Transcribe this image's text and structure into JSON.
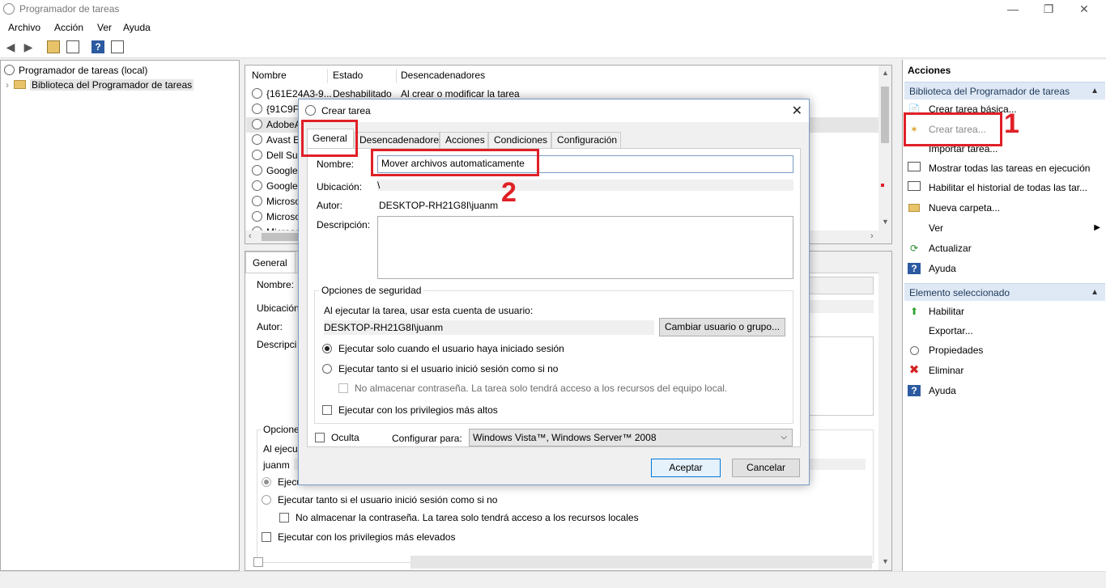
{
  "window": {
    "title": "Programador de tareas",
    "min": "—",
    "max": "❐",
    "close": "✕"
  },
  "menu": [
    "Archivo",
    "Acción",
    "Ver",
    "Ayuda"
  ],
  "tree": {
    "root": "Programador de tareas (local)",
    "child": "Biblioteca del Programador de tareas"
  },
  "list": {
    "headers": [
      "Nombre",
      "Estado",
      "Desencadenadores"
    ],
    "rows": [
      {
        "name": "{161E24A3-9...",
        "state": "Deshabilitado",
        "trigger": "Al crear o modificar la tarea"
      },
      {
        "name": "{91C9F1",
        "state": "",
        "trigger": ""
      },
      {
        "name": "AdobeA",
        "state": "",
        "trigger": ""
      },
      {
        "name": "Avast Er",
        "state": "",
        "trigger": ""
      },
      {
        "name": "Dell Sup",
        "state": "",
        "trigger": ""
      },
      {
        "name": "GoogleU",
        "state": "",
        "trigger": ""
      },
      {
        "name": "GoogleU",
        "state": "",
        "trigger": ""
      },
      {
        "name": "Microso",
        "state": "",
        "trigger": ""
      },
      {
        "name": "Microso",
        "state": "",
        "trigger": ""
      },
      {
        "name": "Microso",
        "state": "",
        "trigger": ""
      }
    ]
  },
  "detail": {
    "tab": "General",
    "nombre": "Nombre:",
    "ubicacion": "Ubicación:",
    "autor": "Autor:",
    "descripcion": "Descripci",
    "opciones": "Opcione",
    "al_ejecutar": "Al ejecu",
    "user": "juanm",
    "radio1": "Ejecu",
    "radio2": "Ejecutar tanto si el usuario inició sesión como si no",
    "chk1": "No almacenar la contraseña. La tarea solo tendrá acceso a los recursos locales",
    "chk2": "Ejecutar con los privilegios más elevados"
  },
  "actions": {
    "title": "Acciones",
    "section1": "Biblioteca del Programador de tareas",
    "items1": [
      "Crear tarea básica...",
      "Crear tarea...",
      "Importar tarea...",
      "Mostrar todas las tareas en ejecución",
      "Habilitar el historial de todas las tar...",
      "Nueva carpeta...",
      "Ver",
      "Actualizar",
      "Ayuda"
    ],
    "section2": "Elemento seleccionado",
    "items2": [
      "Habilitar",
      "Exportar...",
      "Propiedades",
      "Eliminar",
      "Ayuda"
    ]
  },
  "dialog": {
    "title": "Crear tarea",
    "tabs": [
      "General",
      "Desencadenadores",
      "Acciones",
      "Condiciones",
      "Configuración"
    ],
    "nombre_label": "Nombre:",
    "nombre_value": "Mover archivos automaticamente",
    "ubicacion_label": "Ubicación:",
    "ubicacion_value": "\\",
    "autor_label": "Autor:",
    "autor_value": "DESKTOP-RH21G8I\\juanm",
    "descripcion_label": "Descripción:",
    "security_group": "Opciones de seguridad",
    "security_account_label": "Al ejecutar la tarea, usar esta cuenta de usuario:",
    "security_account_value": "DESKTOP-RH21G8I\\juanm",
    "change_user_button": "Cambiar usuario o grupo...",
    "radio_logged": "Ejecutar solo cuando el usuario haya iniciado sesión",
    "radio_any": "Ejecutar tanto si el usuario inició sesión como si no",
    "no_store_password": "No almacenar contraseña. La tarea solo tendrá acceso a los recursos del equipo local.",
    "highest_priv": "Ejecutar con los privilegios más altos",
    "hidden": "Oculta",
    "configure_for_label": "Configurar para:",
    "configure_for_value": "Windows Vista™, Windows Server™ 2008",
    "ok": "Aceptar",
    "cancel": "Cancelar"
  },
  "annotations": {
    "one": "1",
    "two": "2"
  },
  "colors": {
    "annotation_red": "#e02027",
    "section_bg": "#dfe9f5"
  }
}
